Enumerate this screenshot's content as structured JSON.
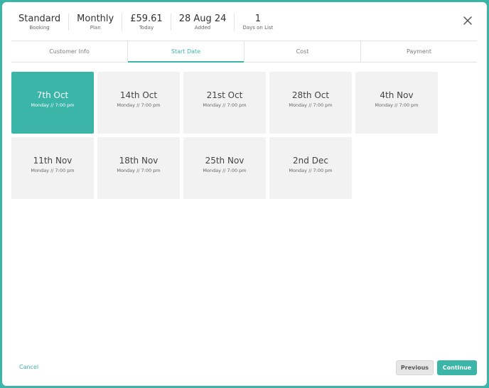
{
  "summary": [
    {
      "value": "Standard",
      "label": "Booking"
    },
    {
      "value": "Monthly",
      "label": "Plan"
    },
    {
      "value": "£59.61",
      "label": "Today"
    },
    {
      "value": "28 Aug 24",
      "label": "Added"
    },
    {
      "value": "1",
      "label": "Days on List"
    }
  ],
  "tabs": [
    {
      "label": "Customer Info",
      "active": false
    },
    {
      "label": "Start Date",
      "active": true
    },
    {
      "label": "Cost",
      "active": false
    },
    {
      "label": "Payment",
      "active": false
    }
  ],
  "dates": [
    {
      "title": "7th Oct",
      "sub": "Monday // 7:00 pm",
      "selected": true
    },
    {
      "title": "14th Oct",
      "sub": "Monday // 7:00 pm",
      "selected": false
    },
    {
      "title": "21st Oct",
      "sub": "Monday // 7:00 pm",
      "selected": false
    },
    {
      "title": "28th Oct",
      "sub": "Monday // 7:00 pm",
      "selected": false
    },
    {
      "title": "4th Nov",
      "sub": "Monday // 7:00 pm",
      "selected": false
    },
    {
      "title": "11th Nov",
      "sub": "Monday // 7:00 pm",
      "selected": false
    },
    {
      "title": "18th Nov",
      "sub": "Monday // 7:00 pm",
      "selected": false
    },
    {
      "title": "25th Nov",
      "sub": "Monday // 7:00 pm",
      "selected": false
    },
    {
      "title": "2nd Dec",
      "sub": "Monday // 7:00 pm",
      "selected": false
    }
  ],
  "footer": {
    "cancel_label": "Cancel",
    "previous_label": "Previous",
    "continue_label": "Continue"
  },
  "icons": {
    "close": "close-icon"
  },
  "colors": {
    "accent": "#3bb5a8",
    "card": "#f2f2f2"
  }
}
